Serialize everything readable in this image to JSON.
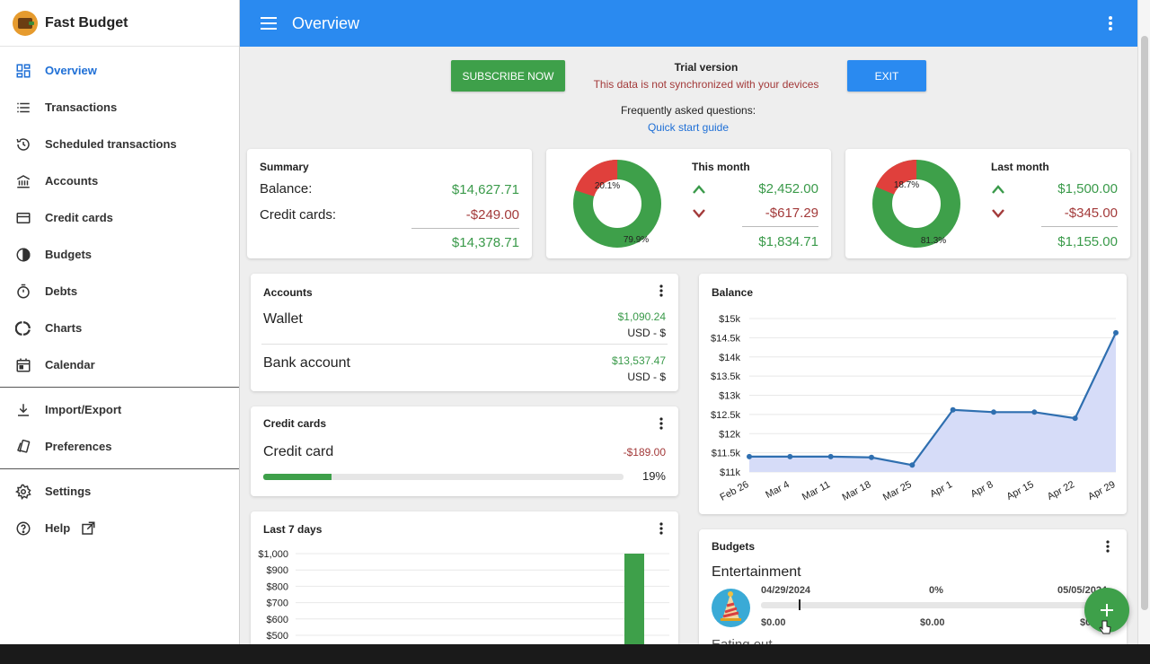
{
  "app": {
    "name": "Fast Budget",
    "logo_icon": "wallet-icon"
  },
  "sidebar": {
    "items": [
      {
        "label": "Overview",
        "icon": "dashboard-icon",
        "active": true
      },
      {
        "label": "Transactions",
        "icon": "list-icon"
      },
      {
        "label": "Scheduled transactions",
        "icon": "history-icon"
      },
      {
        "label": "Accounts",
        "icon": "bank-icon"
      },
      {
        "label": "Credit cards",
        "icon": "credit-card-icon"
      },
      {
        "label": "Budgets",
        "icon": "pie-icon"
      },
      {
        "label": "Debts",
        "icon": "timer-icon"
      },
      {
        "label": "Charts",
        "icon": "donut-icon"
      },
      {
        "label": "Calendar",
        "icon": "calendar-icon"
      },
      {
        "label": "Import/Export",
        "icon": "download-icon"
      },
      {
        "label": "Preferences",
        "icon": "style-icon"
      },
      {
        "label": "Settings",
        "icon": "gear-icon"
      },
      {
        "label": "Help",
        "icon": "help-icon",
        "external_icon": "open-external-icon"
      }
    ]
  },
  "topbar": {
    "title": "Overview"
  },
  "trial": {
    "subscribe_label": "SUBSCRIBE NOW",
    "title": "Trial version",
    "message": "This data is not synchronized with your devices",
    "exit_label": "EXIT",
    "faq_label": "Frequently asked questions:",
    "faq_link": "Quick start guide"
  },
  "summary": {
    "title": "Summary",
    "balance_label": "Balance:",
    "balance_value": "$14,627.71",
    "credit_label": "Credit cards:",
    "credit_value": "-$249.00",
    "total_value": "$14,378.71"
  },
  "this_month": {
    "title": "This month",
    "income": "$2,452.00",
    "expense": "-$617.29",
    "net": "$1,834.71",
    "donut": {
      "red_pct": 20.1,
      "green_pct": 79.9,
      "red_label": "20.1%",
      "green_label": "79.9%"
    }
  },
  "last_month": {
    "title": "Last month",
    "income": "$1,500.00",
    "expense": "-$345.00",
    "net": "$1,155.00",
    "donut": {
      "red_pct": 18.7,
      "green_pct": 81.3,
      "red_label": "18.7%",
      "green_label": "81.3%"
    }
  },
  "accounts": {
    "title": "Accounts",
    "rows": [
      {
        "name": "Wallet",
        "amount": "$1,090.24",
        "currency": "USD - $"
      },
      {
        "name": "Bank account",
        "amount": "$13,537.47",
        "currency": "USD - $"
      }
    ]
  },
  "credit_cards": {
    "title": "Credit cards",
    "rows": [
      {
        "name": "Credit card",
        "amount": "-$189.00",
        "percent_label": "19%",
        "progress": 0.19
      }
    ]
  },
  "last7": {
    "title": "Last 7 days"
  },
  "balance_chart": {
    "title": "Balance"
  },
  "budgets": {
    "title": "Budgets",
    "name": "Entertainment",
    "start_date": "04/29/2024",
    "percent": "0%",
    "end_date": "05/05/2024",
    "spent": "$0.00",
    "mid": "$0.00",
    "limit": "$0.00",
    "next_name": "Eating out",
    "icon": "party-hat-icon"
  },
  "colors": {
    "accent": "#2a8af0",
    "green": "#3a9a4a",
    "red": "#a33a3a",
    "donut_red": "#e0403c",
    "donut_green": "#3ea04a",
    "area": "#d6dcf8",
    "line": "#2f6fb0"
  },
  "chart_data": [
    {
      "type": "area",
      "title": "Balance",
      "categories": [
        "Feb 26",
        "Mar 4",
        "Mar 11",
        "Mar 18",
        "Mar 25",
        "Apr 1",
        "Apr 8",
        "Apr 15",
        "Apr 22",
        "Apr 29"
      ],
      "series": [
        {
          "values": [
            11400,
            11400,
            11400,
            11380,
            11180,
            12620,
            12560,
            12560,
            12400,
            14630
          ]
        }
      ],
      "y_ticks": [
        "$11k",
        "$11.5k",
        "$12k",
        "$12.5k",
        "$13k",
        "$13.5k",
        "$14k",
        "$14.5k",
        "$15k"
      ],
      "ylim": [
        11000,
        15000
      ],
      "grid": true
    },
    {
      "type": "bar",
      "title": "Last 7 days",
      "y_ticks": [
        "$500",
        "$600",
        "$700",
        "$800",
        "$900",
        "$1,000"
      ],
      "ylim": [
        500,
        1000
      ],
      "values": [
        1000
      ],
      "grid": true
    }
  ]
}
